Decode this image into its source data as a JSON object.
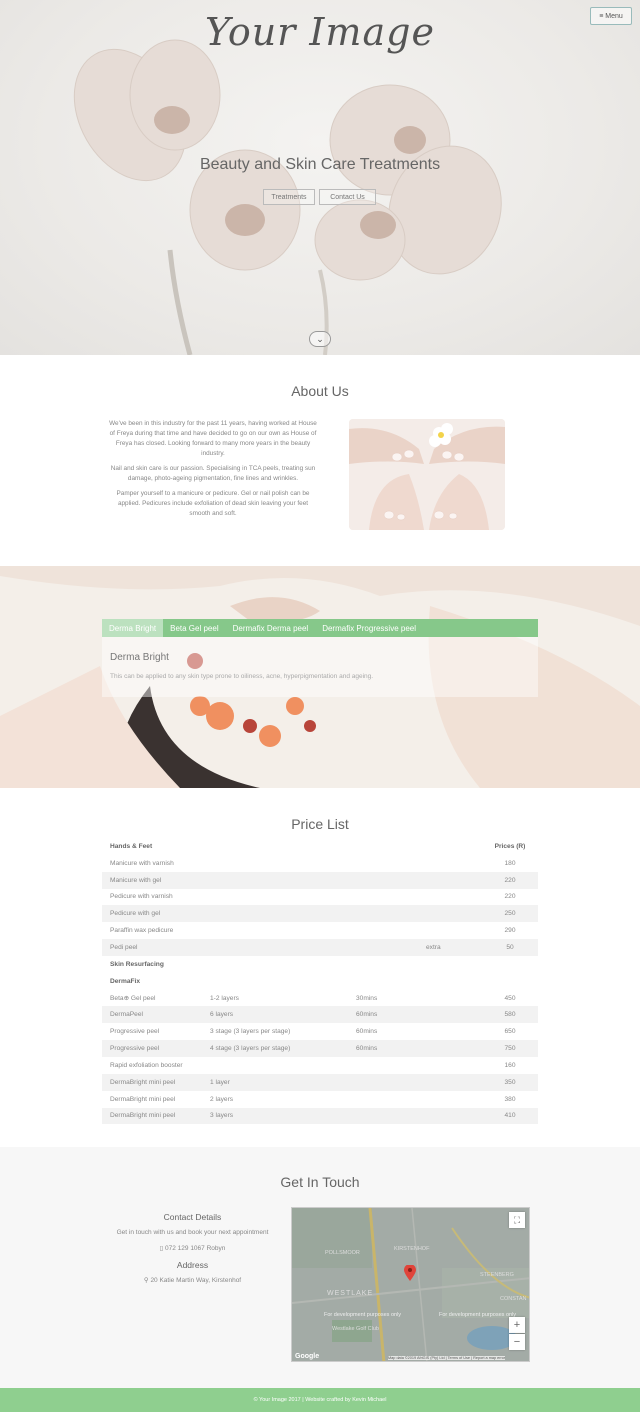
{
  "header": {
    "logo_text": "Your Image",
    "menu_label": "Menu",
    "menu_icon": "hamburger-icon"
  },
  "hero": {
    "title": "Beauty and Skin Care Treatments",
    "buttons": [
      "Treatments",
      "Contact Us"
    ],
    "scroll_icon": "chevron-down-icon"
  },
  "about": {
    "title": "About Us",
    "paragraphs": [
      "We've been in this industry for the past 11 years, having worked at House of Freya during that time and have decided to go on our own as House of Freya has closed. Looking forward to many more years in the beauty industry.",
      "Nail and skin care is our passion. Specialising in TCA peels, treating sun damage, photo-ageing pigmentation, fine lines and wrinkles.",
      "Pamper yourself to a manicure or pedicure. Gel or nail polish can be applied. Pedicures include exfoliation of dead skin leaving your feet smooth and soft."
    ]
  },
  "treatments": {
    "tabs": [
      "Derma Bright",
      "Beta Gel peel",
      "Dermafix Derma peel",
      "Dermafix Progressive peel"
    ],
    "active_tab": 0,
    "panel_title": "Derma Bright",
    "panel_text": "This can be applied to any skin type prone to oiliness, acne, hyperpigmentation and ageing.",
    "accent_color": "#86c88a"
  },
  "price_list": {
    "title": "Price List",
    "rows": [
      {
        "c1": "Hands & Feet",
        "c2": "",
        "c3": "",
        "c4": "",
        "c5": "Prices (R)",
        "kind": "hdr"
      },
      {
        "c1": "Manicure with varnish",
        "c2": "",
        "c3": "",
        "c4": "",
        "c5": "180",
        "kind": "row"
      },
      {
        "c1": "Manicure with gel",
        "c2": "",
        "c3": "",
        "c4": "",
        "c5": "220",
        "kind": "alt"
      },
      {
        "c1": "Pedicure with varnish",
        "c2": "",
        "c3": "",
        "c4": "",
        "c5": "220",
        "kind": "row"
      },
      {
        "c1": "Pedicure with gel",
        "c2": "",
        "c3": "",
        "c4": "",
        "c5": "250",
        "kind": "alt"
      },
      {
        "c1": "Paraffin wax pedicure",
        "c2": "",
        "c3": "",
        "c4": "",
        "c5": "290",
        "kind": "row"
      },
      {
        "c1": "Pedi peel",
        "c2": "",
        "c3": "",
        "c4": "extra",
        "c5": "50",
        "kind": "alt"
      },
      {
        "c1": "Skin Resurfacing",
        "c2": "",
        "c3": "",
        "c4": "",
        "c5": "",
        "kind": "hdr"
      },
      {
        "c1": "DermaFix",
        "c2": "",
        "c3": "",
        "c4": "",
        "c5": "",
        "kind": "hdr"
      },
      {
        "c1": "Beta⊕ Gel peel",
        "c2": "1-2 layers",
        "c3": "30mins",
        "c4": "",
        "c5": "450",
        "kind": "row"
      },
      {
        "c1": "DermaPeel",
        "c2": "6 layers",
        "c3": "60mins",
        "c4": "",
        "c5": "580",
        "kind": "alt"
      },
      {
        "c1": "Progressive peel",
        "c2": "3 stage   (3 layers per stage)",
        "c3": "60mins",
        "c4": "",
        "c5": "650",
        "kind": "row"
      },
      {
        "c1": "Progressive peel",
        "c2": "4 stage   (3 layers per stage)",
        "c3": "60mins",
        "c4": "",
        "c5": "750",
        "kind": "alt"
      },
      {
        "c1": "Rapid exfoliation booster",
        "c2": "",
        "c3": "",
        "c4": "",
        "c5": "160",
        "kind": "row"
      },
      {
        "c1": "DermaBright mini peel",
        "c2": "1 layer",
        "c3": "",
        "c4": "",
        "c5": "350",
        "kind": "alt"
      },
      {
        "c1": "DermaBright mini peel",
        "c2": "2 layers",
        "c3": "",
        "c4": "",
        "c5": "380",
        "kind": "row"
      },
      {
        "c1": "DermaBright mini peel",
        "c2": "3 layers",
        "c3": "",
        "c4": "",
        "c5": "410",
        "kind": "alt"
      }
    ]
  },
  "contact": {
    "title": "Get In Touch",
    "details_heading": "Contact Details",
    "details_text": "Get in touch with us and book your next appointment",
    "phone": "072 129 1067   Robyn",
    "phone_icon": "mobile-phone-icon",
    "address_heading": "Address",
    "address": "20 Katie Martin Way, Kirstenhof",
    "address_icon": "map-marker-icon"
  },
  "map": {
    "labels": [
      "POLLSMOOR",
      "KIRSTENHOF",
      "STEENBERG",
      "WESTLAKE",
      "CONSTAN",
      "Westlake Golf Club"
    ],
    "dev_notice": "For development purposes only",
    "attribution": "Map data ©2019 AfriGIS (Pty) Ltd | Terms of Use | Report a map error",
    "google_label": "Google",
    "zoom_in": "+",
    "zoom_out": "−"
  },
  "footer": {
    "text": "© Your Image 2017 | Website crafted by Kevin Michael"
  }
}
